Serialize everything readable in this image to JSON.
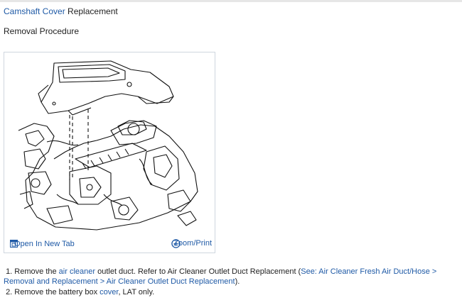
{
  "header": {
    "title_link": "Camshaft Cover",
    "title_rest": " Replacement",
    "subtitle": "Removal Procedure"
  },
  "figure": {
    "open_tab_label": "Open In New Tab",
    "zoom_label": "Zoom/Print"
  },
  "steps": {
    "s1": {
      "num": "1. ",
      "t1": "Remove the ",
      "l1": "air cleaner",
      "t2": " outlet duct. Refer to Air Cleaner Outlet Duct Replacement (",
      "l2": "See: Air Cleaner Fresh Air Duct/Hose > Removal and Replacement > Air Cleaner Outlet Duct Replacement",
      "t3": ")."
    },
    "s2": {
      "num": "2. ",
      "t1": "Remove the battery box ",
      "l1": "cover",
      "t2": ", LAT only."
    }
  }
}
